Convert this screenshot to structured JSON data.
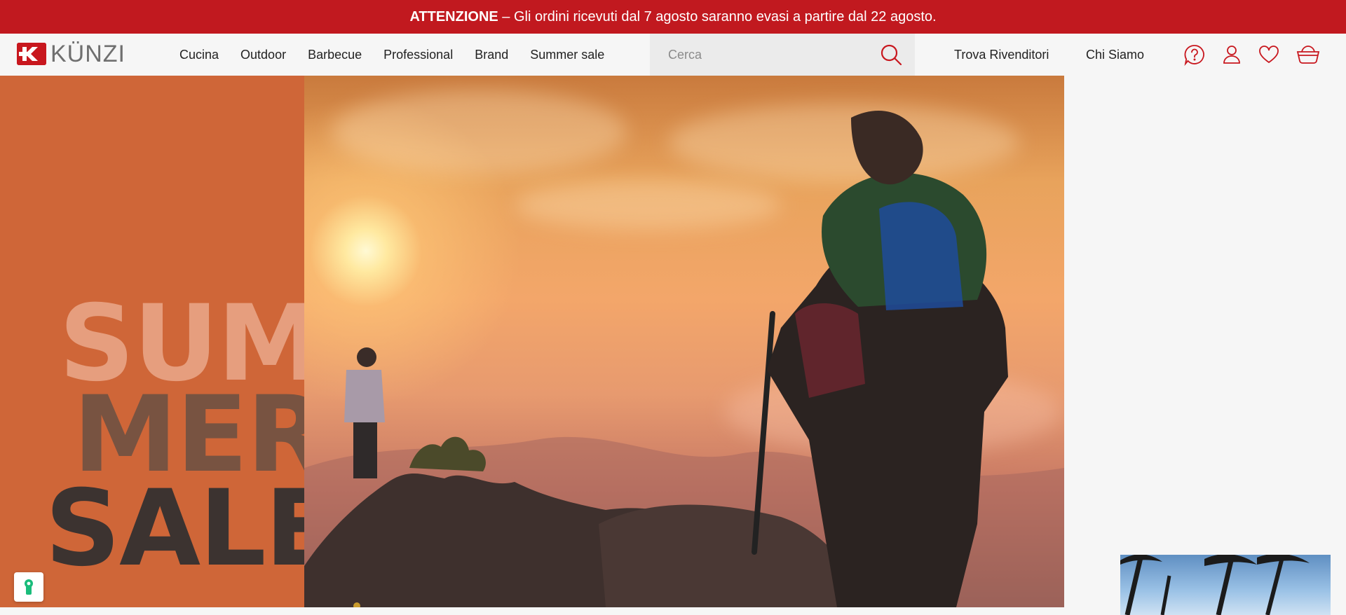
{
  "announcement": {
    "label": "ATTENZIONE",
    "separator": " – ",
    "message": "Gli ordini ricevuti dal 7 agosto saranno evasi a partire dal 22 agosto."
  },
  "brand": {
    "name": "KÜNZI",
    "color": "#c8171e"
  },
  "nav": {
    "items": [
      "Cucina",
      "Outdoor",
      "Barbecue",
      "Professional",
      "Brand",
      "Summer sale"
    ]
  },
  "search": {
    "placeholder": "Cerca",
    "icon": "search-icon"
  },
  "header_links": {
    "dealers": "Trova Rivenditori",
    "about": "Chi Siamo"
  },
  "header_icons": [
    "help-icon",
    "account-icon",
    "wishlist-icon",
    "cart-icon"
  ],
  "hero": {
    "headline_lines": [
      "SUM",
      "MER",
      "SALE"
    ],
    "accent_color": "#cf6638",
    "slide_count_visible": 1
  },
  "colors": {
    "announcement_bg": "#c1191f",
    "icon_red": "#c8171e"
  }
}
